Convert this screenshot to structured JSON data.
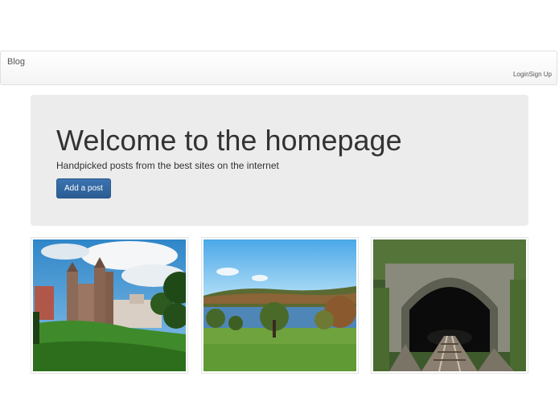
{
  "navbar": {
    "brand": "Blog",
    "login_label": "Login",
    "signup_label": "Sign Up"
  },
  "jumbotron": {
    "title": "Welcome to the homepage",
    "subtitle": "Handpicked posts from the best sites on the internet",
    "add_post_label": "Add a post"
  },
  "posts": [
    {
      "image": "castle-photo"
    },
    {
      "image": "lake-landscape-photo"
    },
    {
      "image": "railway-tunnel-photo"
    }
  ],
  "colors": {
    "button": "#2b5d93",
    "jumbotron_bg": "#ececec"
  }
}
